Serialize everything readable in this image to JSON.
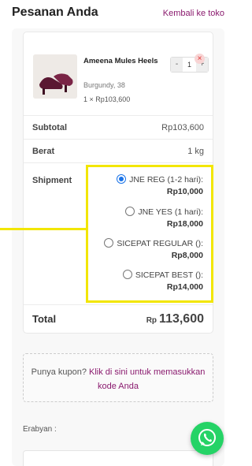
{
  "header": {
    "title": "Pesanan Anda",
    "back_link": "Kembali ke toko"
  },
  "cart": {
    "items": [
      {
        "name": "Ameena Mules Heels",
        "variant": "Burgundy, 38",
        "price_line": "1 × Rp103,600",
        "quantity": "1",
        "minus": "-",
        "plus": "+",
        "remove": "×"
      }
    ]
  },
  "summary": {
    "subtotal_label": "Subtotal",
    "subtotal_value": "Rp103,600",
    "weight_label": "Berat",
    "weight_value": "1 kg",
    "shipment_label": "Shipment",
    "shipment_options": [
      {
        "name": "JNE REG (1-2 hari):",
        "price": "Rp10,000",
        "selected": true
      },
      {
        "name": "JNE YES (1 hari):",
        "price": "Rp18,000",
        "selected": false
      },
      {
        "name": "SICEPAT REGULAR ():",
        "price": "Rp8,000",
        "selected": false
      },
      {
        "name": "SICEPAT BEST ():",
        "price": "Rp14,000",
        "selected": false
      }
    ],
    "total_label": "Total",
    "total_currency": "Rp",
    "total_value": "113,600"
  },
  "coupon": {
    "prompt": "Punya kupon?",
    "link": "Klik di sini untuk memasukkan kode Anda"
  },
  "notes": {
    "label": "Erabyan :"
  },
  "colors": {
    "accent": "#8a1a6e",
    "highlight": "#f2e600",
    "radio_selected": "#1a73e8",
    "whatsapp": "#25d366"
  },
  "icons": {
    "product_image": "shoe-image",
    "chat": "whatsapp-icon"
  }
}
